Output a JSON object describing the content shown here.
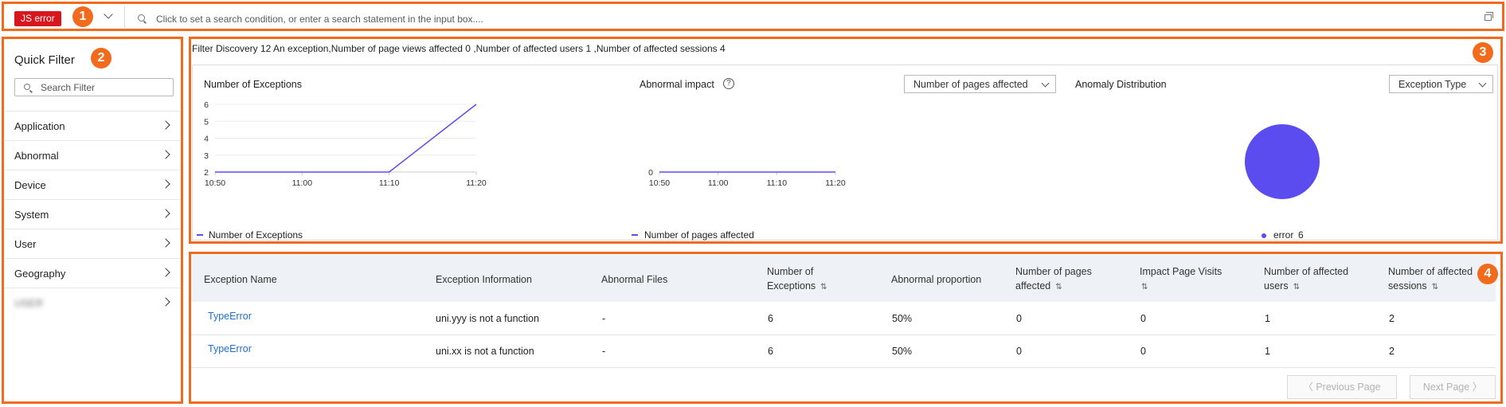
{
  "search_bar": {
    "tag": "JS error",
    "placeholder": "Click to set a search condition, or enter a search statement in the input box...."
  },
  "callouts": [
    "1",
    "2",
    "3",
    "4"
  ],
  "quick_filter": {
    "title": "Quick Filter",
    "search_placeholder": "Search Filter",
    "items": [
      {
        "label": "Application"
      },
      {
        "label": "Abnormal"
      },
      {
        "label": "Device"
      },
      {
        "label": "System"
      },
      {
        "label": "User"
      },
      {
        "label": "Geography"
      },
      {
        "label": "USER"
      }
    ]
  },
  "summary": {
    "text": "Filter Discovery 12 An exception,Number of page views affected 0 ,Number of affected users 1 ,Number of affected sessions 4"
  },
  "panels": {
    "exceptions": {
      "title": "Number of Exceptions",
      "legend": "Number of Exceptions"
    },
    "impact": {
      "title": "Abnormal impact",
      "dropdown": "Number of pages affected",
      "legend": "Number of pages affected"
    },
    "distribution": {
      "title": "Anomaly Distribution",
      "dropdown": "Exception Type",
      "legend": "error",
      "legend_value": "6"
    }
  },
  "chart_data": [
    {
      "type": "line",
      "title": "Number of Exceptions",
      "x": [
        "10:50",
        "11:00",
        "11:10",
        "11:20"
      ],
      "series": [
        {
          "name": "Number of Exceptions",
          "values": [
            2,
            2,
            2,
            6
          ]
        }
      ],
      "yticks": [
        "2",
        "3",
        "4",
        "5",
        "6"
      ],
      "ylim": [
        2,
        6
      ],
      "color": "#5b4cf0"
    },
    {
      "type": "line",
      "title": "Abnormal impact",
      "x": [
        "10:50",
        "11:00",
        "11:10",
        "11:20"
      ],
      "series": [
        {
          "name": "Number of pages affected",
          "values": [
            0,
            0,
            0,
            0
          ]
        }
      ],
      "yticks": [
        "0"
      ],
      "color": "#5b4cf0"
    },
    {
      "type": "pie",
      "title": "Anomaly Distribution",
      "slices": [
        {
          "name": "error",
          "value": 6
        }
      ],
      "color": "#5b4cf0"
    }
  ],
  "table": {
    "headers": [
      {
        "label": "Exception Name",
        "sortable": false
      },
      {
        "label": "Exception Information",
        "sortable": false
      },
      {
        "label": "Abnormal Files",
        "sortable": false
      },
      {
        "label": "Number of Exceptions",
        "line1": "Number of",
        "line2": "Exceptions",
        "sortable": true
      },
      {
        "label": "Abnormal proportion",
        "sortable": false
      },
      {
        "label": "Number of pages affected",
        "line1": "Number of pages",
        "line2": "affected",
        "sortable": true
      },
      {
        "label": "Impact Page Visits",
        "line1": "Impact Page Visits",
        "line2": "",
        "sortable": true
      },
      {
        "label": "Number of affected users",
        "line1": "Number of affected",
        "line2": "users",
        "sortable": true
      },
      {
        "label": "Number of affected sessions",
        "line1": "Number of affected",
        "line2": "sessions",
        "sortable": true
      }
    ],
    "rows": [
      [
        "TypeError",
        "uni.yyy is not a function",
        "-",
        "6",
        "50%",
        "0",
        "0",
        "1",
        "2"
      ],
      [
        "TypeError",
        "uni.xx is not a function",
        "-",
        "6",
        "50%",
        "0",
        "0",
        "1",
        "2"
      ]
    ],
    "prev_label": "Previous Page",
    "next_label": "Next Page"
  },
  "colors": {
    "accent_orange": "#f26b1d",
    "tag_red": "#d7161d",
    "series_purple": "#5b4cf0",
    "link_blue": "#1f6fd1"
  }
}
